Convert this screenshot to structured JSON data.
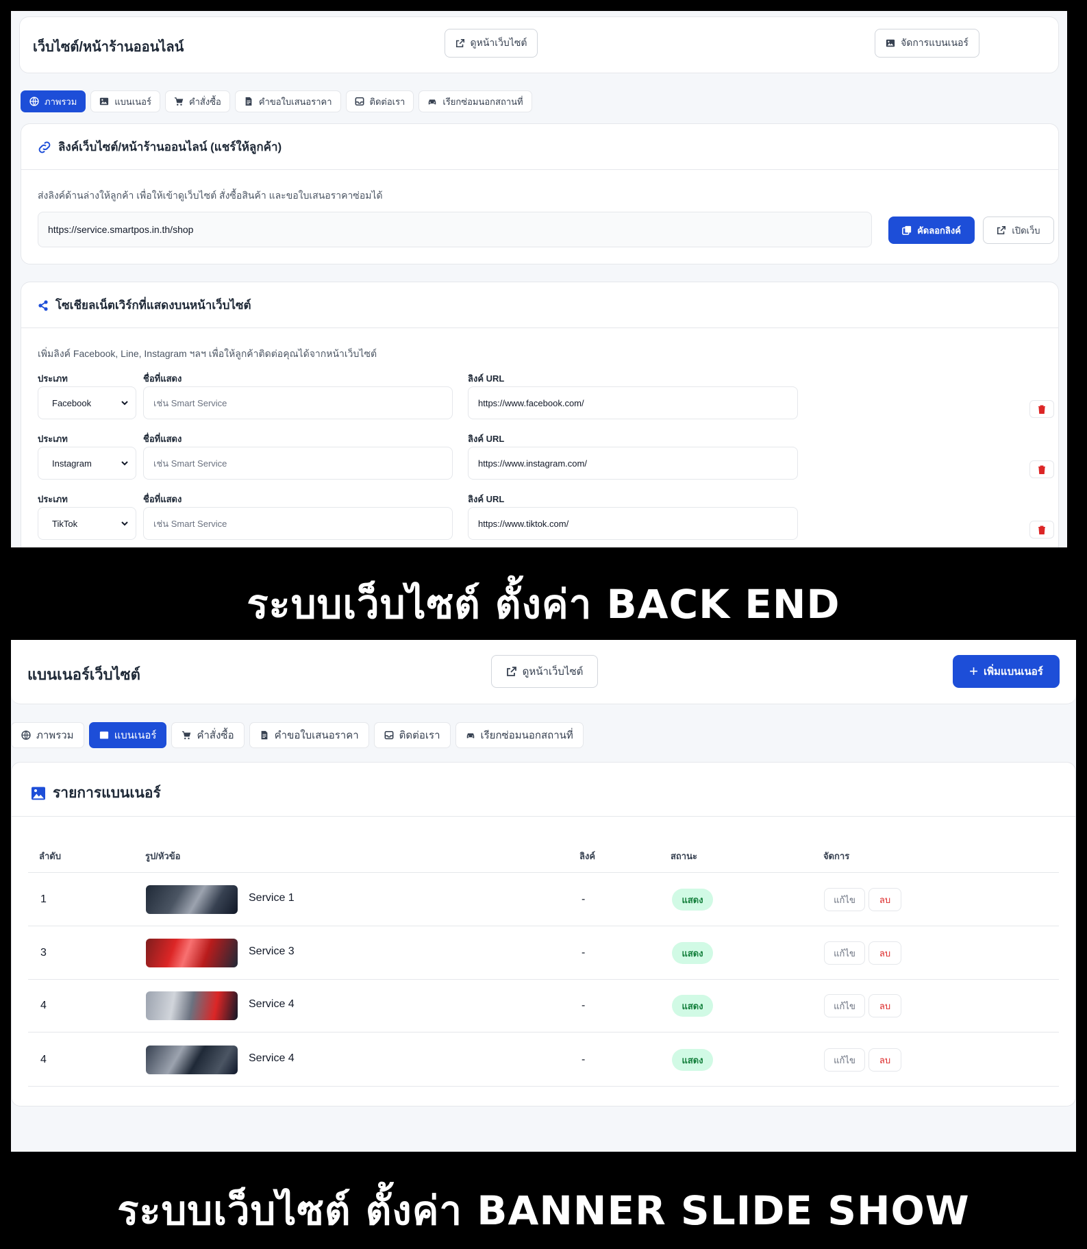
{
  "colors": {
    "primary": "#1d4ed8",
    "background": "#f5f7fa",
    "danger": "#dc2626",
    "success_bg": "#d1fae5",
    "success_text": "#15803d"
  },
  "tabs": [
    {
      "label": "ภาพรวม",
      "icon": "globe-icon"
    },
    {
      "label": "แบนเนอร์",
      "icon": "image-icon"
    },
    {
      "label": "คำสั่งซื้อ",
      "icon": "cart-icon"
    },
    {
      "label": "คำขอใบเสนอราคา",
      "icon": "document-icon"
    },
    {
      "label": "ติดต่อเรา",
      "icon": "inbox-icon"
    },
    {
      "label": "เรียกซ่อมนอกสถานที่",
      "icon": "car-icon"
    }
  ],
  "screen1": {
    "title": "เว็บไซต์/หน้าร้านออนไลน์",
    "view_site_button": "ดูหน้าเว็บไซต์",
    "manage_banner_button": "จัดการแบนเนอร์",
    "active_tab": "ภาพรวม",
    "link_card": {
      "heading": "ลิงค์เว็บไซต์/หน้าร้านออนไลน์ (แชร์ให้ลูกค้า)",
      "description": "ส่งลิงค์ด้านล่างให้ลูกค้า เพื่อให้เข้าดูเว็บไซต์ สั่งซื้อสินค้า และขอใบเสนอราคาซ่อมได้",
      "url": "https://service.smartpos.in.th/shop",
      "copy_button": "คัดลอกลิงค์",
      "open_button": "เปิดเว็บ"
    },
    "social_card": {
      "heading": "โซเชียลเน็ตเวิร์กที่แสดงบนหน้าเว็บไซต์",
      "description": "เพิ่มลิงค์ Facebook, Line, Instagram ฯลฯ เพื่อให้ลูกค้าติดต่อคุณได้จากหน้าเว็บไซต์",
      "type_label": "ประเภท",
      "name_label": "ชื่อที่แสดง",
      "url_label": "ลิงค์ URL",
      "name_placeholder": "เช่น Smart Service",
      "rows": [
        {
          "type": "Facebook",
          "url": "https://www.facebook.com/"
        },
        {
          "type": "Instagram",
          "url": "https://www.instagram.com/"
        },
        {
          "type": "TikTok",
          "url": "https://www.tiktok.com/"
        }
      ]
    }
  },
  "caption1": "ระบบเว็บไซต์ ตั้งค่า BACK END",
  "screen2": {
    "title": "แบนเนอร์เว็บไซต์",
    "view_site_button": "ดูหน้าเว็บไซต์",
    "add_banner_button": "เพิ่มแบนเนอร์",
    "active_tab": "แบนเนอร์",
    "list_heading": "รายการแบนเนอร์",
    "columns": [
      "ลำดับ",
      "รูป/หัวข้อ",
      "ลิงค์",
      "สถานะ",
      "จัดการ"
    ],
    "rows": [
      {
        "order": "1",
        "title": "Service 1",
        "link": "-",
        "status": "แสดง",
        "edit": "แก้ไข",
        "delete": "ลบ"
      },
      {
        "order": "3",
        "title": "Service 3",
        "link": "-",
        "status": "แสดง",
        "edit": "แก้ไข",
        "delete": "ลบ"
      },
      {
        "order": "4",
        "title": "Service 4",
        "link": "-",
        "status": "แสดง",
        "edit": "แก้ไข",
        "delete": "ลบ"
      },
      {
        "order": "4",
        "title": "Service 4",
        "link": "-",
        "status": "แสดง",
        "edit": "แก้ไข",
        "delete": "ลบ"
      }
    ]
  },
  "caption2": "ระบบเว็บไซต์ ตั้งค่า BANNER SLIDE SHOW"
}
